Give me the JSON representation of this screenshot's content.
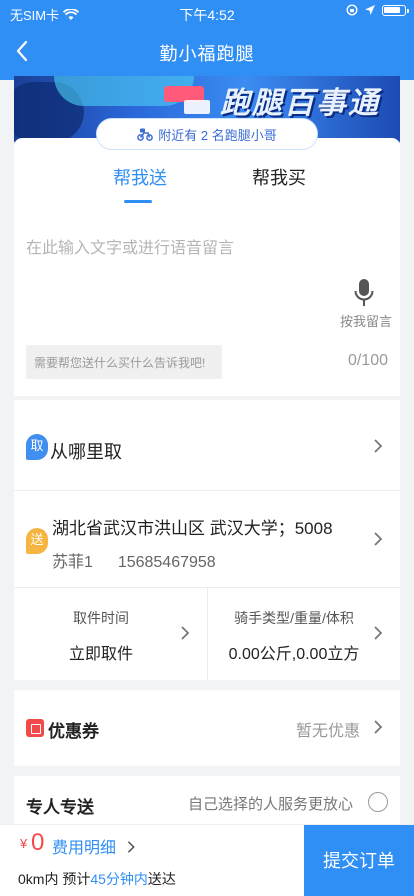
{
  "status_bar": {
    "carrier": "无SIM卡",
    "time": "下午4:52"
  },
  "nav": {
    "title": "勤小福跑腿"
  },
  "banner": {
    "slogan": "跑腿百事通"
  },
  "nearby": {
    "text": "附近有 2 名跑腿小哥"
  },
  "tabs": [
    {
      "label": "帮我送",
      "active": true
    },
    {
      "label": "帮我买",
      "active": false
    }
  ],
  "description": {
    "placeholder": "在此输入文字或进行语音留言",
    "voice_label": "按我留言",
    "hint": "需要帮您送什么买什么告诉我吧!",
    "counter": "0/100"
  },
  "pickup": {
    "badge": "取",
    "label": "从哪里取",
    "badge_color": "#3f8ef0"
  },
  "delivery": {
    "badge": "送",
    "badge_color": "#f5b540",
    "address": "湖北省武汉市洪山区 武汉大学；5008",
    "contact_name": "苏菲1",
    "contact_phone": "15685467958"
  },
  "pickup_time": {
    "label": "取件时间",
    "value": "立即取件"
  },
  "rider_spec": {
    "label": "骑手类型/重量/体积",
    "value": "0.00公斤,0.00立方"
  },
  "coupon": {
    "label": "优惠券",
    "value": "暂无优惠"
  },
  "special_delivery": {
    "label": "专人专送",
    "desc": "自己选择的人服务更放心",
    "checked": false
  },
  "footer": {
    "currency": "¥",
    "price": "0",
    "detail_link": "费用明细",
    "eta_prefix": "0km内 预计",
    "eta_time": "45分钟内",
    "eta_suffix": "送达",
    "submit_label": "提交订单"
  },
  "colors": {
    "primary": "#2f8ff5",
    "price": "#f24a4a",
    "coupon_icon": "#f24a4a"
  }
}
